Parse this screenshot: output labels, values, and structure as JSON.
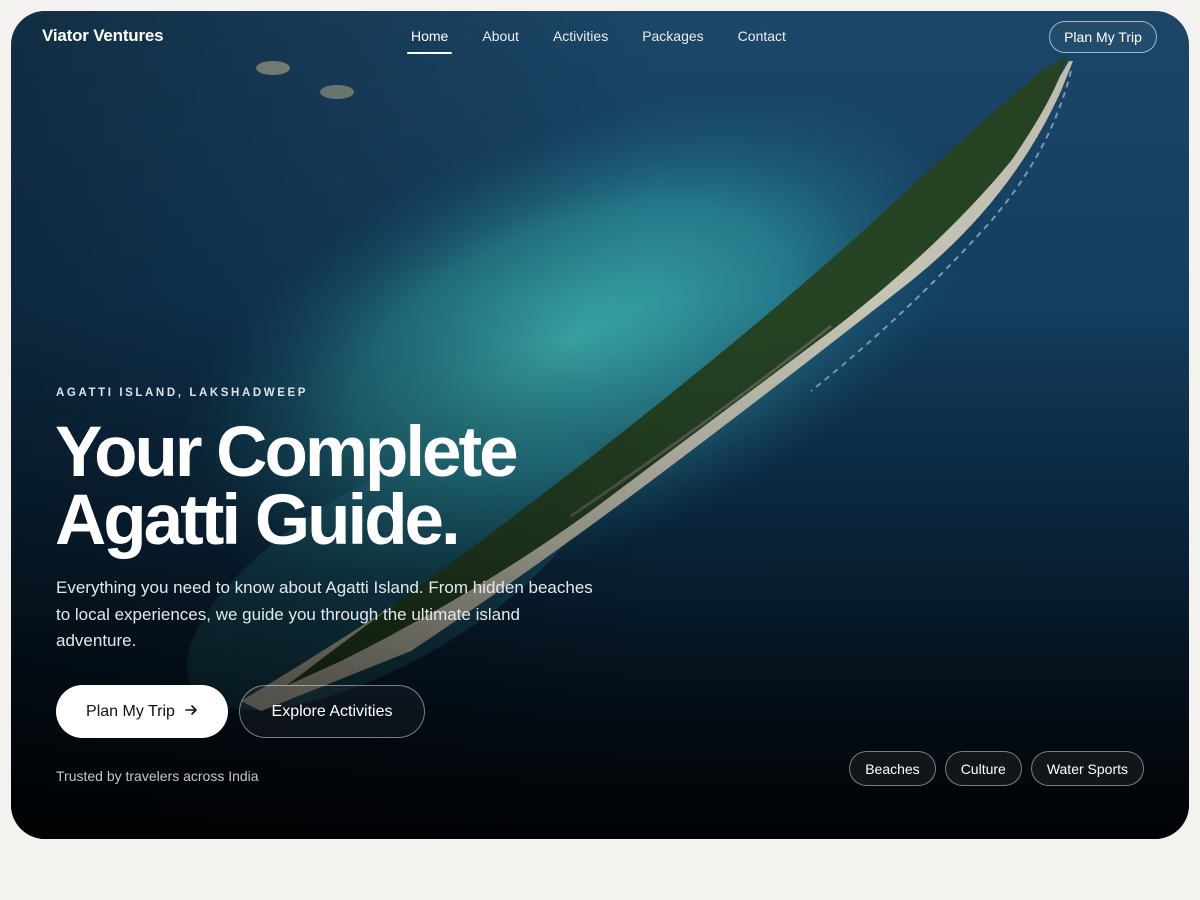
{
  "brand": "Viator Ventures",
  "nav": {
    "items": [
      {
        "label": "Home",
        "active": true
      },
      {
        "label": "About",
        "active": false
      },
      {
        "label": "Activities",
        "active": false
      },
      {
        "label": "Packages",
        "active": false
      },
      {
        "label": "Contact",
        "active": false
      }
    ],
    "cta_label": "Plan My Trip"
  },
  "hero": {
    "eyebrow": "AGATTI ISLAND, LAKSHADWEEP",
    "title_line1": "Your Complete",
    "title_line2": "Agatti Guide.",
    "description": "Everything you need to know about Agatti Island. From hidden beaches to local experiences, we guide you through the ultimate island adventure.",
    "primary_button": "Plan My Trip",
    "primary_button_icon": "arrow-right-icon",
    "secondary_button": "Explore Activities",
    "trusted_text": "Trusted by travelers across India",
    "tags": [
      "Beaches",
      "Culture",
      "Water Sports"
    ]
  },
  "colors": {
    "page_background": "#f4f2ee",
    "ocean_deep": "#0b2a44",
    "lagoon": "#2a9aa0",
    "island_green": "#2f4f2c",
    "text_primary": "#ffffff"
  }
}
